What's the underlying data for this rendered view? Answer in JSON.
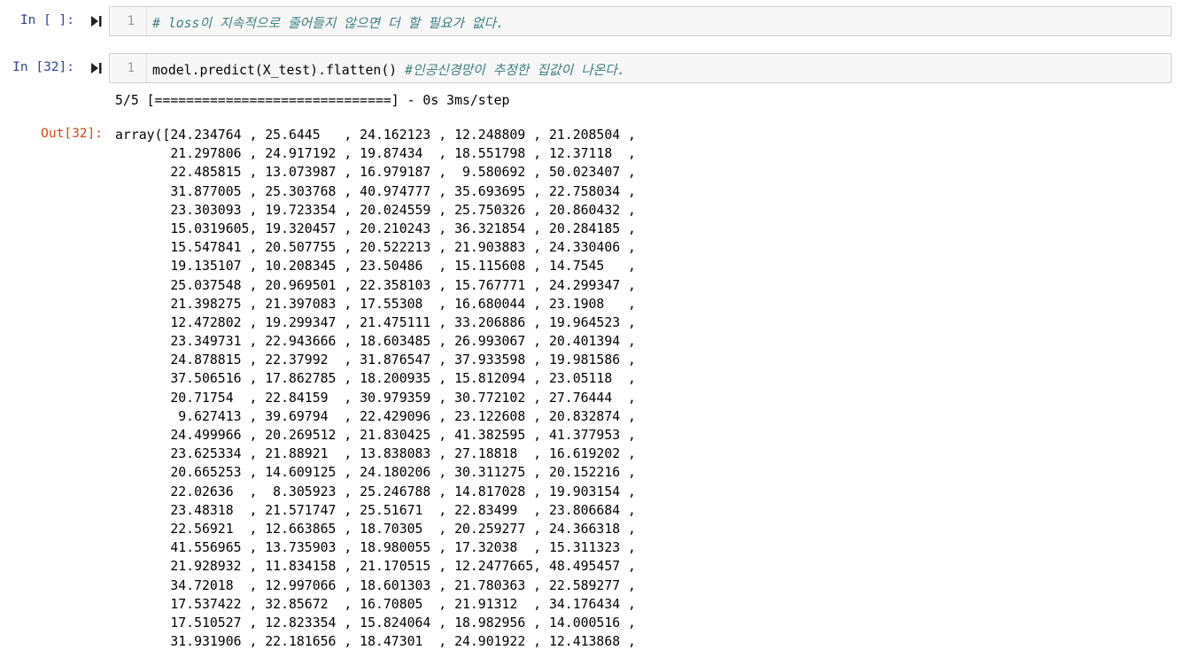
{
  "cells": [
    {
      "prompt": "In [ ]:",
      "line_number": "1",
      "code": "",
      "comment": "# loss이 지속적으로 줄어들지 않으면 더 할 필요가 없다."
    },
    {
      "prompt": "In [32]:",
      "line_number": "1",
      "code": "model.predict(X_test).flatten() ",
      "comment": "#인공신경망이 추정한 집값이 나온다."
    }
  ],
  "stream_output": "5/5 [==============================] - 0s 3ms/step",
  "output": {
    "prompt": "Out[32]:",
    "rows": [
      "array([24.234764 , 25.6445   , 24.162123 , 12.248809 , 21.208504 ,",
      "       21.297806 , 24.917192 , 19.87434  , 18.551798 , 12.37118  ,",
      "       22.485815 , 13.073987 , 16.979187 ,  9.580692 , 50.023407 ,",
      "       31.877005 , 25.303768 , 40.974777 , 35.693695 , 22.758034 ,",
      "       23.303093 , 19.723354 , 20.024559 , 25.750326 , 20.860432 ,",
      "       15.0319605, 19.320457 , 20.210243 , 36.321854 , 20.284185 ,",
      "       15.547841 , 20.507755 , 20.522213 , 21.903883 , 24.330406 ,",
      "       19.135107 , 10.208345 , 23.50486  , 15.115608 , 14.7545   ,",
      "       25.037548 , 20.969501 , 22.358103 , 15.767771 , 24.299347 ,",
      "       21.398275 , 21.397083 , 17.55308  , 16.680044 , 23.1908   ,",
      "       12.472802 , 19.299347 , 21.475111 , 33.206886 , 19.964523 ,",
      "       23.349731 , 22.943666 , 18.603485 , 26.993067 , 20.401394 ,",
      "       24.878815 , 22.37992  , 31.876547 , 37.933598 , 19.981586 ,",
      "       37.506516 , 17.862785 , 18.200935 , 15.812094 , 23.05118  ,",
      "       20.71754  , 22.84159  , 30.979359 , 30.772102 , 27.76444  ,",
      "        9.627413 , 39.69794  , 22.429096 , 23.122608 , 20.832874 ,",
      "       24.499966 , 20.269512 , 21.830425 , 41.382595 , 41.377953 ,",
      "       23.625334 , 21.88921  , 13.838083 , 27.18818  , 16.619202 ,",
      "       20.665253 , 14.609125 , 24.180206 , 30.311275 , 20.152216 ,",
      "       22.02636  ,  8.305923 , 25.246788 , 14.817028 , 19.903154 ,",
      "       23.48318  , 21.571747 , 25.51671  , 22.83499  , 23.806684 ,",
      "       22.56921  , 12.663865 , 18.70305  , 20.259277 , 24.366318 ,",
      "       41.556965 , 13.735903 , 18.980055 , 17.32038  , 15.311323 ,",
      "       21.928932 , 11.834158 , 21.170515 , 12.2477665, 48.495457 ,",
      "       34.72018  , 12.997066 , 18.601303 , 21.780363 , 22.589277 ,",
      "       17.537422 , 32.85672  , 16.70805  , 21.91312  , 34.176434 ,",
      "       17.510527 , 12.823354 , 15.824064 , 18.982956 , 14.000516 ,",
      "       31.931906 , 22.181656 , 18.47301  , 24.901922 , 12.413868 ,"
    ]
  },
  "colors": {
    "in_prompt": "#303f9f",
    "out_prompt": "#d84315",
    "comment": "#408080",
    "cell_background": "#f7f7f7",
    "cell_border": "#cfcfcf"
  },
  "icons": {
    "run": "run-cell-icon"
  }
}
